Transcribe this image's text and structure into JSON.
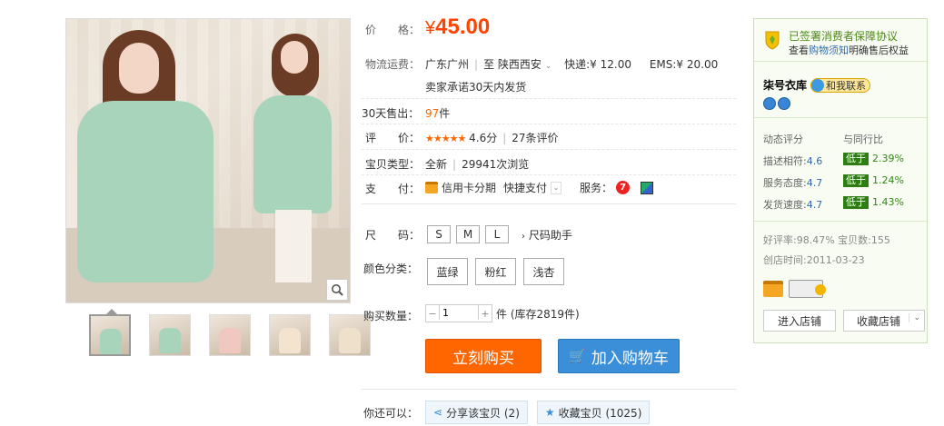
{
  "gallery": {
    "zoom_icon": "magnifier-icon",
    "thumbnail_count": 5
  },
  "price": {
    "label": "价　　格：",
    "currency": "¥",
    "value": "45.00"
  },
  "shipping": {
    "label": "物流运费：",
    "from": "广东广州",
    "to_prefix": "至",
    "to": "陕西西安",
    "express": "快递:¥ 12.00",
    "ems": "EMS:¥ 20.00",
    "promise": "卖家承诺30天内发货"
  },
  "sold": {
    "label": "30天售出：",
    "count": "97",
    "unit": "件"
  },
  "rating": {
    "label": "评　　价：",
    "stars": "★★★★★",
    "score": "4.6分",
    "reviews": "27条评价"
  },
  "type": {
    "label": "宝贝类型：",
    "condition": "全新",
    "views": "29941次浏览"
  },
  "payment": {
    "label": "支　　付：",
    "credit": "信用卡分期",
    "quick": "快捷支付",
    "service_label": "服务："
  },
  "size": {
    "label": "尺　　码：",
    "options": [
      "S",
      "M",
      "L"
    ],
    "helper": "尺码助手"
  },
  "color": {
    "label": "颜色分类：",
    "options": [
      "蓝绿",
      "粉红",
      "浅杏"
    ]
  },
  "quantity": {
    "label": "购买数量：",
    "value": "1",
    "stock": "件 (库存2819件)"
  },
  "actions": {
    "buy_now": "立刻购买",
    "add_cart": "加入购物车"
  },
  "share": {
    "label": "你还可以：",
    "share_btn": "分享该宝贝 (2)",
    "fav_btn": "收藏宝贝 (1025)"
  },
  "seller": {
    "protect_title": "已签署消费者保障协议",
    "protect_prefix": "查看",
    "protect_link": "购物须知",
    "protect_suffix": "明确售后权益",
    "shop_name": "柒号衣库",
    "contact": "和我联系",
    "dynamic_label": "动态评分",
    "compare_label": "与同行比",
    "scores": [
      {
        "name": "描述相符:",
        "value": "4.6",
        "tag": "低于",
        "pct": "2.39%"
      },
      {
        "name": "服务态度:",
        "value": "4.7",
        "tag": "低于",
        "pct": "1.24%"
      },
      {
        "name": "发货速度:",
        "value": "4.7",
        "tag": "低于",
        "pct": "1.43%"
      }
    ],
    "good_rate": "好评率:98.47%",
    "item_count": "宝贝数:155",
    "created": "创店时间:2011-03-23",
    "enter_shop": "进入店铺",
    "fav_shop": "收藏店铺"
  }
}
